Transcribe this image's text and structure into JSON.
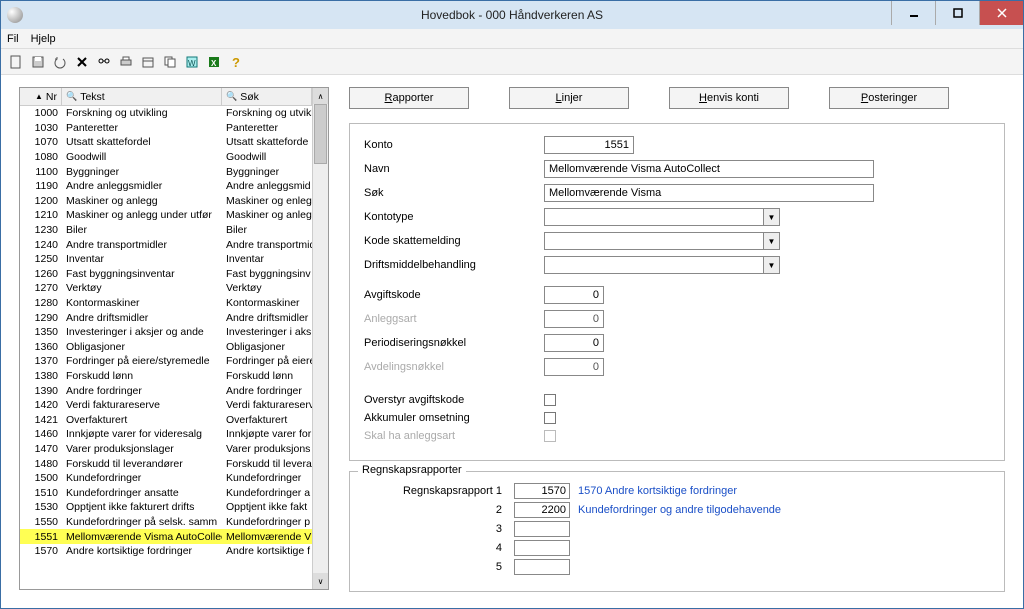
{
  "window": {
    "title": "Hovedbok - 000 Håndverkeren AS"
  },
  "menu": {
    "file": "Fil",
    "help": "Hjelp"
  },
  "toolbar_icons": [
    "new",
    "save",
    "undo",
    "delete",
    "find",
    "print",
    "calendar",
    "copy",
    "wizard",
    "excel",
    "help"
  ],
  "grid": {
    "headers": {
      "nr": "Nr",
      "tekst": "Tekst",
      "sok": "Søk"
    },
    "rows": [
      {
        "nr": "1000",
        "tekst": "Forskning og utvikling",
        "sok": "Forskning og utvikl",
        "sel": false
      },
      {
        "nr": "1030",
        "tekst": "Panteretter",
        "sok": "Panteretter",
        "sel": false
      },
      {
        "nr": "1070",
        "tekst": "Utsatt skattefordel",
        "sok": "Utsatt skatteforde",
        "sel": false
      },
      {
        "nr": "1080",
        "tekst": "Goodwill",
        "sok": "Goodwill",
        "sel": false
      },
      {
        "nr": "1100",
        "tekst": "Byggninger",
        "sok": "Byggninger",
        "sel": false
      },
      {
        "nr": "1190",
        "tekst": "Andre anleggsmidler",
        "sok": "Andre anleggsmid",
        "sel": false
      },
      {
        "nr": "1200",
        "tekst": "Maskiner og anlegg",
        "sok": "Maskiner og enleg",
        "sel": false
      },
      {
        "nr": "1210",
        "tekst": "Maskiner og anlegg under utfør",
        "sok": "Maskiner og anleg",
        "sel": false
      },
      {
        "nr": "1230",
        "tekst": "Biler",
        "sok": "Biler",
        "sel": false
      },
      {
        "nr": "1240",
        "tekst": "Andre transportmidler",
        "sok": "Andre transportmid",
        "sel": false
      },
      {
        "nr": "1250",
        "tekst": "Inventar",
        "sok": "Inventar",
        "sel": false
      },
      {
        "nr": "1260",
        "tekst": "Fast byggningsinventar",
        "sok": "Fast byggningsinv",
        "sel": false
      },
      {
        "nr": "1270",
        "tekst": "Verktøy",
        "sok": "Verktøy",
        "sel": false
      },
      {
        "nr": "1280",
        "tekst": "Kontormaskiner",
        "sok": "Kontormaskiner",
        "sel": false
      },
      {
        "nr": "1290",
        "tekst": "Andre driftsmidler",
        "sok": "Andre driftsmidler",
        "sel": false
      },
      {
        "nr": "1350",
        "tekst": "Investeringer i aksjer og ande",
        "sok": "Investeringer i aks",
        "sel": false
      },
      {
        "nr": "1360",
        "tekst": "Obligasjoner",
        "sok": "Obligasjoner",
        "sel": false
      },
      {
        "nr": "1370",
        "tekst": "Fordringer på eiere/styremedle",
        "sok": "Fordringer på eiere",
        "sel": false
      },
      {
        "nr": "1380",
        "tekst": "Forskudd lønn",
        "sok": "Forskudd lønn",
        "sel": false
      },
      {
        "nr": "1390",
        "tekst": "Andre fordringer",
        "sok": "Andre fordringer",
        "sel": false
      },
      {
        "nr": "1420",
        "tekst": "Verdi fakturareserve",
        "sok": "Verdi fakturareserv",
        "sel": false
      },
      {
        "nr": "1421",
        "tekst": "Overfakturert",
        "sok": "Overfakturert",
        "sel": false
      },
      {
        "nr": "1460",
        "tekst": "Innkjøpte varer for videresalg",
        "sok": "Innkjøpte varer for",
        "sel": false
      },
      {
        "nr": "1470",
        "tekst": "Varer produksjonslager",
        "sok": "Varer produksjons",
        "sel": false
      },
      {
        "nr": "1480",
        "tekst": "Forskudd til leverandører",
        "sok": "Forskudd til levera",
        "sel": false
      },
      {
        "nr": "1500",
        "tekst": "Kundefordringer",
        "sok": "Kundefordringer",
        "sel": false
      },
      {
        "nr": "1510",
        "tekst": "Kundefordringer ansatte",
        "sok": "Kundefordringer a",
        "sel": false
      },
      {
        "nr": "1530",
        "tekst": "Opptjent ikke fakturert drifts",
        "sok": "Opptjent ikke fakt",
        "sel": false
      },
      {
        "nr": "1550",
        "tekst": "Kundefordringer på selsk. samm",
        "sok": "Kundefordringer p",
        "sel": false
      },
      {
        "nr": "1551",
        "tekst": "Mellomværende Visma AutoCollec",
        "sok": "Mellomværende V",
        "sel": true
      },
      {
        "nr": "1570",
        "tekst": "Andre kortsiktige fordringer",
        "sok": "Andre kortsiktige f",
        "sel": false
      }
    ]
  },
  "actions": {
    "rapporter": "Rapporter",
    "linjer": "Linjer",
    "henvis": "Henvis konti",
    "posteringer": "Posteringer"
  },
  "form": {
    "labels": {
      "konto": "Konto",
      "navn": "Navn",
      "sok": "Søk",
      "kontotype": "Kontotype",
      "kode_skatt": "Kode skattemelding",
      "driftsmiddel": "Driftsmiddelbehandling",
      "avgiftskode": "Avgiftskode",
      "anleggsart": "Anleggsart",
      "period": "Periodiseringsnøkkel",
      "avdeling": "Avdelingsnøkkel",
      "overstyr": "Overstyr avgiftskode",
      "akkumuler": "Akkumuler omsetning",
      "skalha": "Skal ha anleggsart"
    },
    "values": {
      "konto": "1551",
      "navn": "Mellomværende Visma AutoCollect",
      "sok": "Mellomværende Visma",
      "kontotype": "",
      "kode_skatt": "",
      "driftsmiddel": "",
      "avgiftskode": "0",
      "anleggsart": "0",
      "period": "0",
      "avdeling": "0"
    }
  },
  "regnskap": {
    "legend": "Regnskapsrapporter",
    "label1": "Regnskapsrapport 1",
    "rows": [
      {
        "n": "",
        "code": "1570",
        "link": "1570 Andre kortsiktige fordringer"
      },
      {
        "n": "2",
        "code": "2200",
        "link": "Kundefordringer og andre tilgodehavende"
      },
      {
        "n": "3",
        "code": "",
        "link": ""
      },
      {
        "n": "4",
        "code": "",
        "link": ""
      },
      {
        "n": "5",
        "code": "",
        "link": ""
      }
    ]
  }
}
